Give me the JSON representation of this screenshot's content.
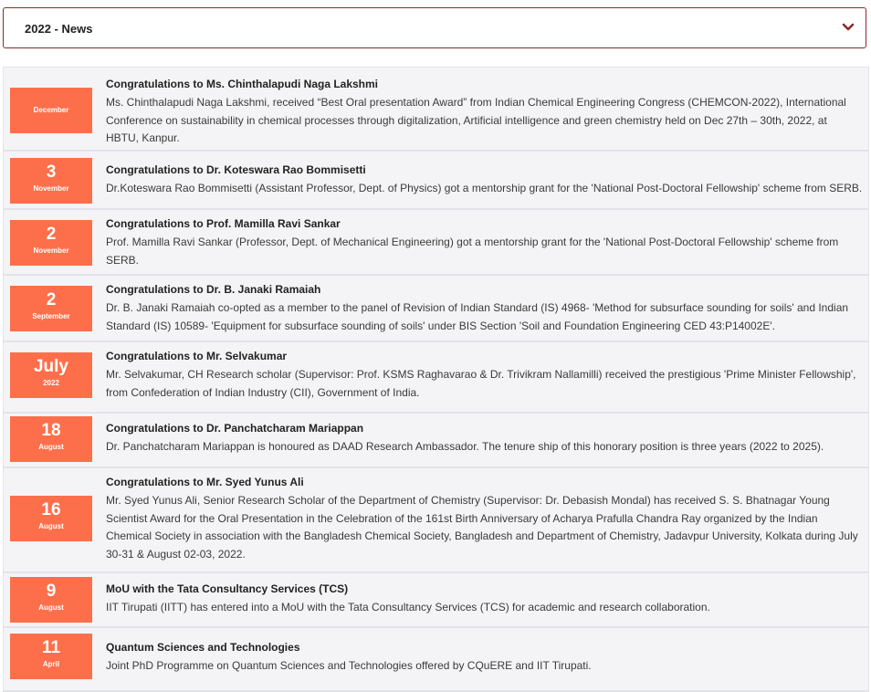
{
  "accordion": {
    "title": "2022 - News",
    "accent_color": "#8b2a2a"
  },
  "date_color": "#fd6f4b",
  "news": [
    {
      "day": "",
      "month": "December",
      "title": "Congratulations to Ms. Chinthalapudi Naga Lakshmi",
      "body": "Ms. Chinthalapudi Naga Lakshmi, received “Best Oral presentation Award” from Indian Chemical Engineering Congress (CHEMCON-2022), International Conference on sustainability in chemical processes through digitalization, Artificial intelligence and green chemistry held on Dec 27th – 30th, 2022, at HBTU, Kanpur."
    },
    {
      "day": "3",
      "month": "November",
      "title": "Congratulations to Dr. Koteswara Rao Bommisetti",
      "body": "Dr.Koteswara Rao Bommisetti (Assistant Professor, Dept. of Physics) got a mentorship grant for the 'National Post-Doctoral Fellowship' scheme from SERB."
    },
    {
      "day": "2",
      "month": "November",
      "title": "Congratulations to Prof. Mamilla Ravi Sankar",
      "body": "Prof. Mamilla Ravi Sankar (Professor, Dept. of Mechanical Engineering) got a mentorship grant for the 'National Post-Doctoral Fellowship' scheme from SERB."
    },
    {
      "day": "2",
      "month": "September",
      "title": "Congratulations to Dr. B. Janaki Ramaiah",
      "body": "Dr. B. Janaki Ramaiah co-opted as a member to the panel of Revision of Indian Standard (IS) 4968- 'Method for subsurface sounding for soils' and Indian Standard (IS) 10589- 'Equipment for subsurface sounding of soils' under BIS Section 'Soil and Foundation Engineering CED 43:P14002E'."
    },
    {
      "day": "July",
      "month": "2022",
      "title": "Congratulations to Mr. Selvakumar",
      "body": "Mr. Selvakumar, CH Research scholar (Supervisor: Prof. KSMS Raghavarao & Dr. Trivikram Nallamilli) received the prestigious 'Prime Minister Fellowship', from Confederation of Indian Industry (CII), Government of India."
    },
    {
      "day": "18",
      "month": "August",
      "title": "Congratulations to Dr. Panchatcharam Mariappan",
      "body": "Dr. Panchatcharam Mariappan is honoured as DAAD Research Ambassador. The tenure ship of this honorary position is three years (2022 to 2025)."
    },
    {
      "day": "16",
      "month": "August",
      "title": "Congratulations to Mr. Syed Yunus Ali",
      "body": "Mr. Syed Yunus Ali, Senior Research Scholar of the Department of Chemistry (Supervisor: Dr. Debasish Mondal) has received S. S. Bhatnagar Young Scientist Award for the Oral Presentation in the Celebration of the 161st Birth Anniversary of Acharya Prafulla Chandra Ray organized by the Indian Chemical Society in association with the Bangladesh Chemical Society, Bangladesh and Department of Chemistry, Jadavpur University, Kolkata during July 30-31 & August 02-03, 2022."
    },
    {
      "day": "9",
      "month": "August",
      "title": "MoU with the Tata Consultancy Services (TCS)",
      "body": "IIT Tirupati (IITT) has entered into a MoU with the Tata Consultancy Services (TCS) for academic and research collaboration."
    },
    {
      "day": "11",
      "month": "April",
      "title": "Quantum Sciences and Technologies",
      "body": "Joint PhD Programme on Quantum Sciences and Technologies offered by CQuERE and IIT Tirupati."
    }
  ]
}
